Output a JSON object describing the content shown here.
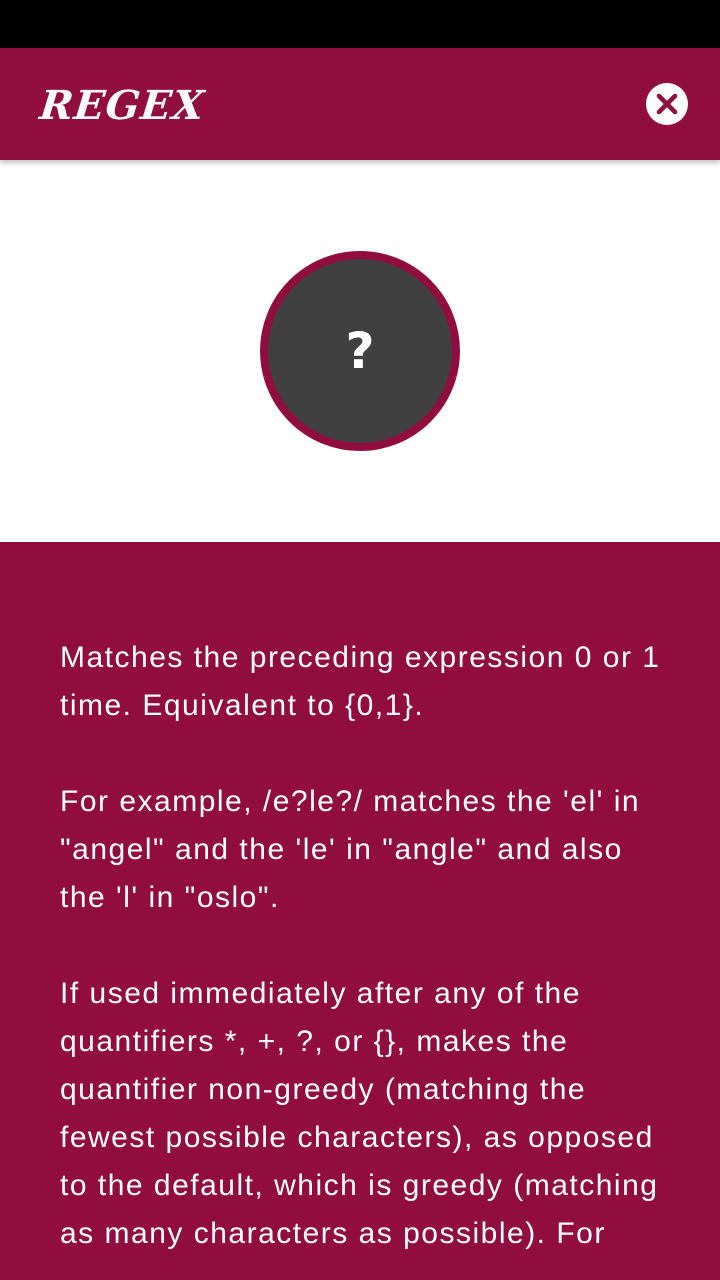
{
  "colors": {
    "primary": "#910D3E",
    "status_bar": "#000000",
    "symbol_background": "#404040",
    "text_on_primary": "#FFFFFF"
  },
  "app_bar": {
    "title": "REGEX",
    "close_icon": "close-circle-icon"
  },
  "hero": {
    "symbol": "?"
  },
  "description": {
    "paragraphs": [
      "Matches the preceding expression 0 or 1 time. Equivalent to {0,1}.",
      "For example, /e?le?/ matches the 'el' in \"angel\" and the 'le' in \"angle\" and also the 'l' in \"oslo\".",
      "If used immediately after any of the quantifiers *, +, ?, or {}, makes the quantifier non-greedy (matching the fewest possible characters), as opposed to the default, which is greedy (matching as many characters as possible). For"
    ]
  }
}
